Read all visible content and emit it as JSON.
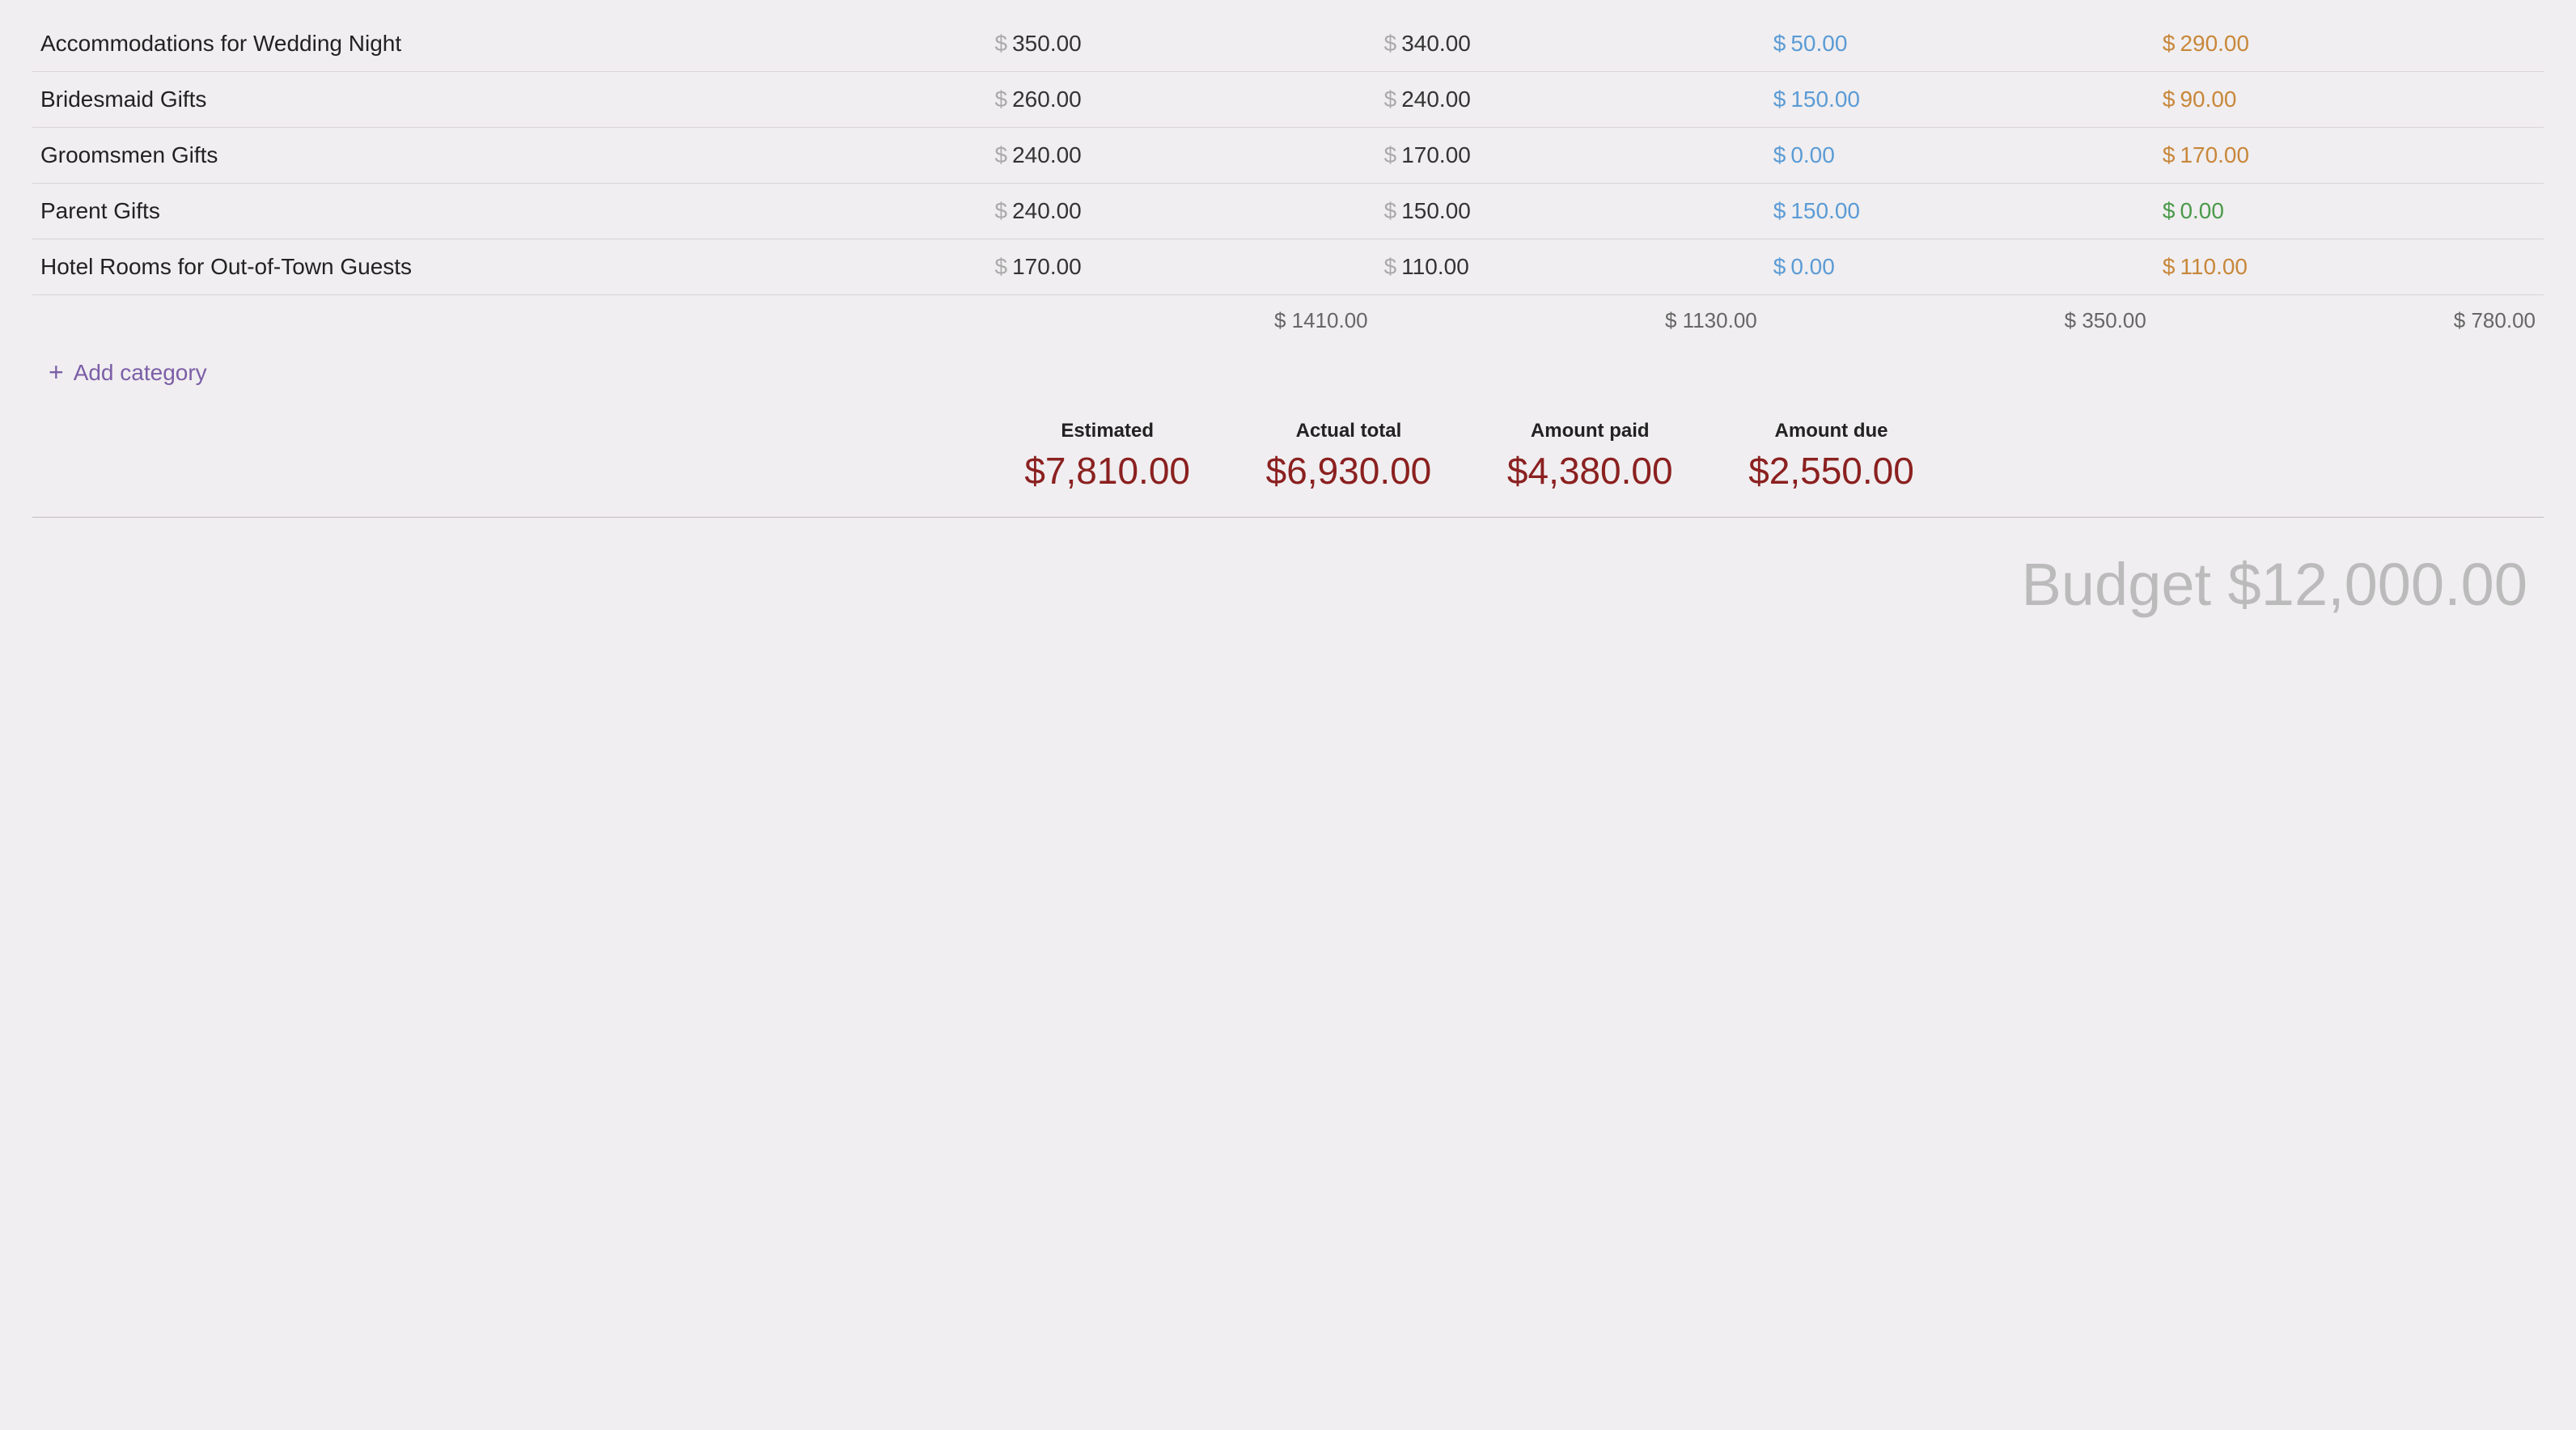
{
  "table": {
    "rows": [
      {
        "name": "Accommodations for Wedding Night",
        "estimated": "350.00",
        "actual": "340.00",
        "paid": "50.00",
        "due": "290.00",
        "paid_color": "blue",
        "due_color": "orange"
      },
      {
        "name": "Bridesmaid Gifts",
        "estimated": "260.00",
        "actual": "240.00",
        "paid": "150.00",
        "due": "90.00",
        "paid_color": "blue",
        "due_color": "orange"
      },
      {
        "name": "Groomsmen Gifts",
        "estimated": "240.00",
        "actual": "170.00",
        "paid": "0.00",
        "due": "170.00",
        "paid_color": "blue",
        "due_color": "orange"
      },
      {
        "name": "Parent Gifts",
        "estimated": "240.00",
        "actual": "150.00",
        "paid": "150.00",
        "due": "0.00",
        "paid_color": "blue",
        "due_color": "green"
      },
      {
        "name": "Hotel Rooms for Out-of-Town Guests",
        "estimated": "170.00",
        "actual": "110.00",
        "paid": "0.00",
        "due": "110.00",
        "paid_color": "blue",
        "due_color": "orange"
      }
    ],
    "totals": {
      "estimated": "$ 1410.00",
      "actual": "$ 1130.00",
      "paid": "$ 350.00",
      "due": "$ 780.00"
    }
  },
  "add_category_label": "Add category",
  "summary": {
    "estimated_label": "Estimated",
    "estimated_value": "$7,810.00",
    "actual_label": "Actual total",
    "actual_value": "$6,930.00",
    "paid_label": "Amount paid",
    "paid_value": "$4,380.00",
    "due_label": "Amount due",
    "due_value": "$2,550.00"
  },
  "budget_label": "Budget $12,000.00"
}
